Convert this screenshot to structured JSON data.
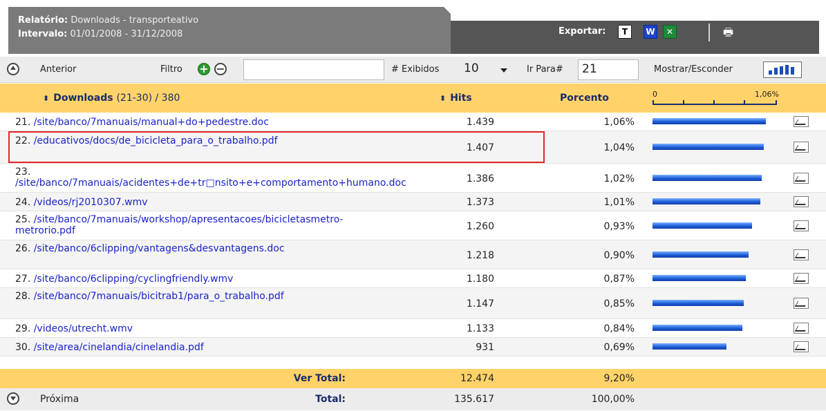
{
  "header": {
    "report_label": "Relatório:",
    "report_value": "Downloads - transporteativo",
    "interval_label": "Intervalo:",
    "interval_value": "01/01/2008 - 31/12/2008",
    "export_label": "Exportar:",
    "export_icons": [
      "text-export-icon",
      "word-export-icon",
      "excel-export-icon",
      "print-icon"
    ]
  },
  "toolbar": {
    "prev_label": "Anterior",
    "filter_label": "Filtro",
    "filter_value": "",
    "shown_label": "# Exibidos",
    "shown_value": "10",
    "goto_label": "Ir Para#",
    "goto_value": "21",
    "toggle_label": "Mostrar/Esconder"
  },
  "table": {
    "col_downloads": "Downloads",
    "col_range": "(21-30) / 380",
    "col_hits": "Hits",
    "col_percent": "Porcento",
    "scale_min": "0",
    "scale_max": "1,06%",
    "rows": [
      {
        "num": "21.",
        "path": "/site/banco/7manuais/manual+do+pedestre.doc",
        "hits": "1.439",
        "percent": "1,06%",
        "share": 1.06
      },
      {
        "num": "22.",
        "path": "/educativos/docs/de_bicicleta_para_o_trabalho.pdf",
        "hits": "1.407",
        "percent": "1,04%",
        "share": 1.04
      },
      {
        "num": "23.",
        "path": "/site/banco/7manuais/acidentes+de+tr□nsito+e+comportamento+humano.doc",
        "hits": "1.386",
        "percent": "1,02%",
        "share": 1.02
      },
      {
        "num": "24.",
        "path": "/videos/rj2010307.wmv",
        "hits": "1.373",
        "percent": "1,01%",
        "share": 1.01
      },
      {
        "num": "25.",
        "path": "/site/banco/7manuais/workshop/apresentacoes/bicicletasmetro-metrorio.pdf",
        "hits": "1.260",
        "percent": "0,93%",
        "share": 0.93
      },
      {
        "num": "26.",
        "path": "/site/banco/6clipping/vantagens&desvantagens.doc",
        "hits": "1.218",
        "percent": "0,90%",
        "share": 0.9
      },
      {
        "num": "27.",
        "path": "/site/banco/6clipping/cyclingfriendly.wmv",
        "hits": "1.180",
        "percent": "0,87%",
        "share": 0.87
      },
      {
        "num": "28.",
        "path": "/site/banco/7manuais/bicitrab1/para_o_trabalho.pdf",
        "hits": "1.147",
        "percent": "0,85%",
        "share": 0.85
      },
      {
        "num": "29.",
        "path": "/videos/utrecht.wmv",
        "hits": "1.133",
        "percent": "0,84%",
        "share": 0.84
      },
      {
        "num": "30.",
        "path": "/site/area/cinelandia/cinelandia.pdf",
        "hits": "931",
        "percent": "0,69%",
        "share": 0.69
      }
    ]
  },
  "totals": {
    "view_label": "Ver Total:",
    "view_hits": "12.474",
    "view_percent": "9,20%",
    "next_label": "Próxima",
    "total_label": "Total:",
    "total_hits": "135.617",
    "total_percent": "100,00%"
  },
  "colors": {
    "header_gray": "#7b7b7b",
    "accent_yellow": "#ffd36a",
    "link_blue": "#1b22c9",
    "bar_blue": "#1f5fd9",
    "highlight_red": "#e3262c"
  }
}
